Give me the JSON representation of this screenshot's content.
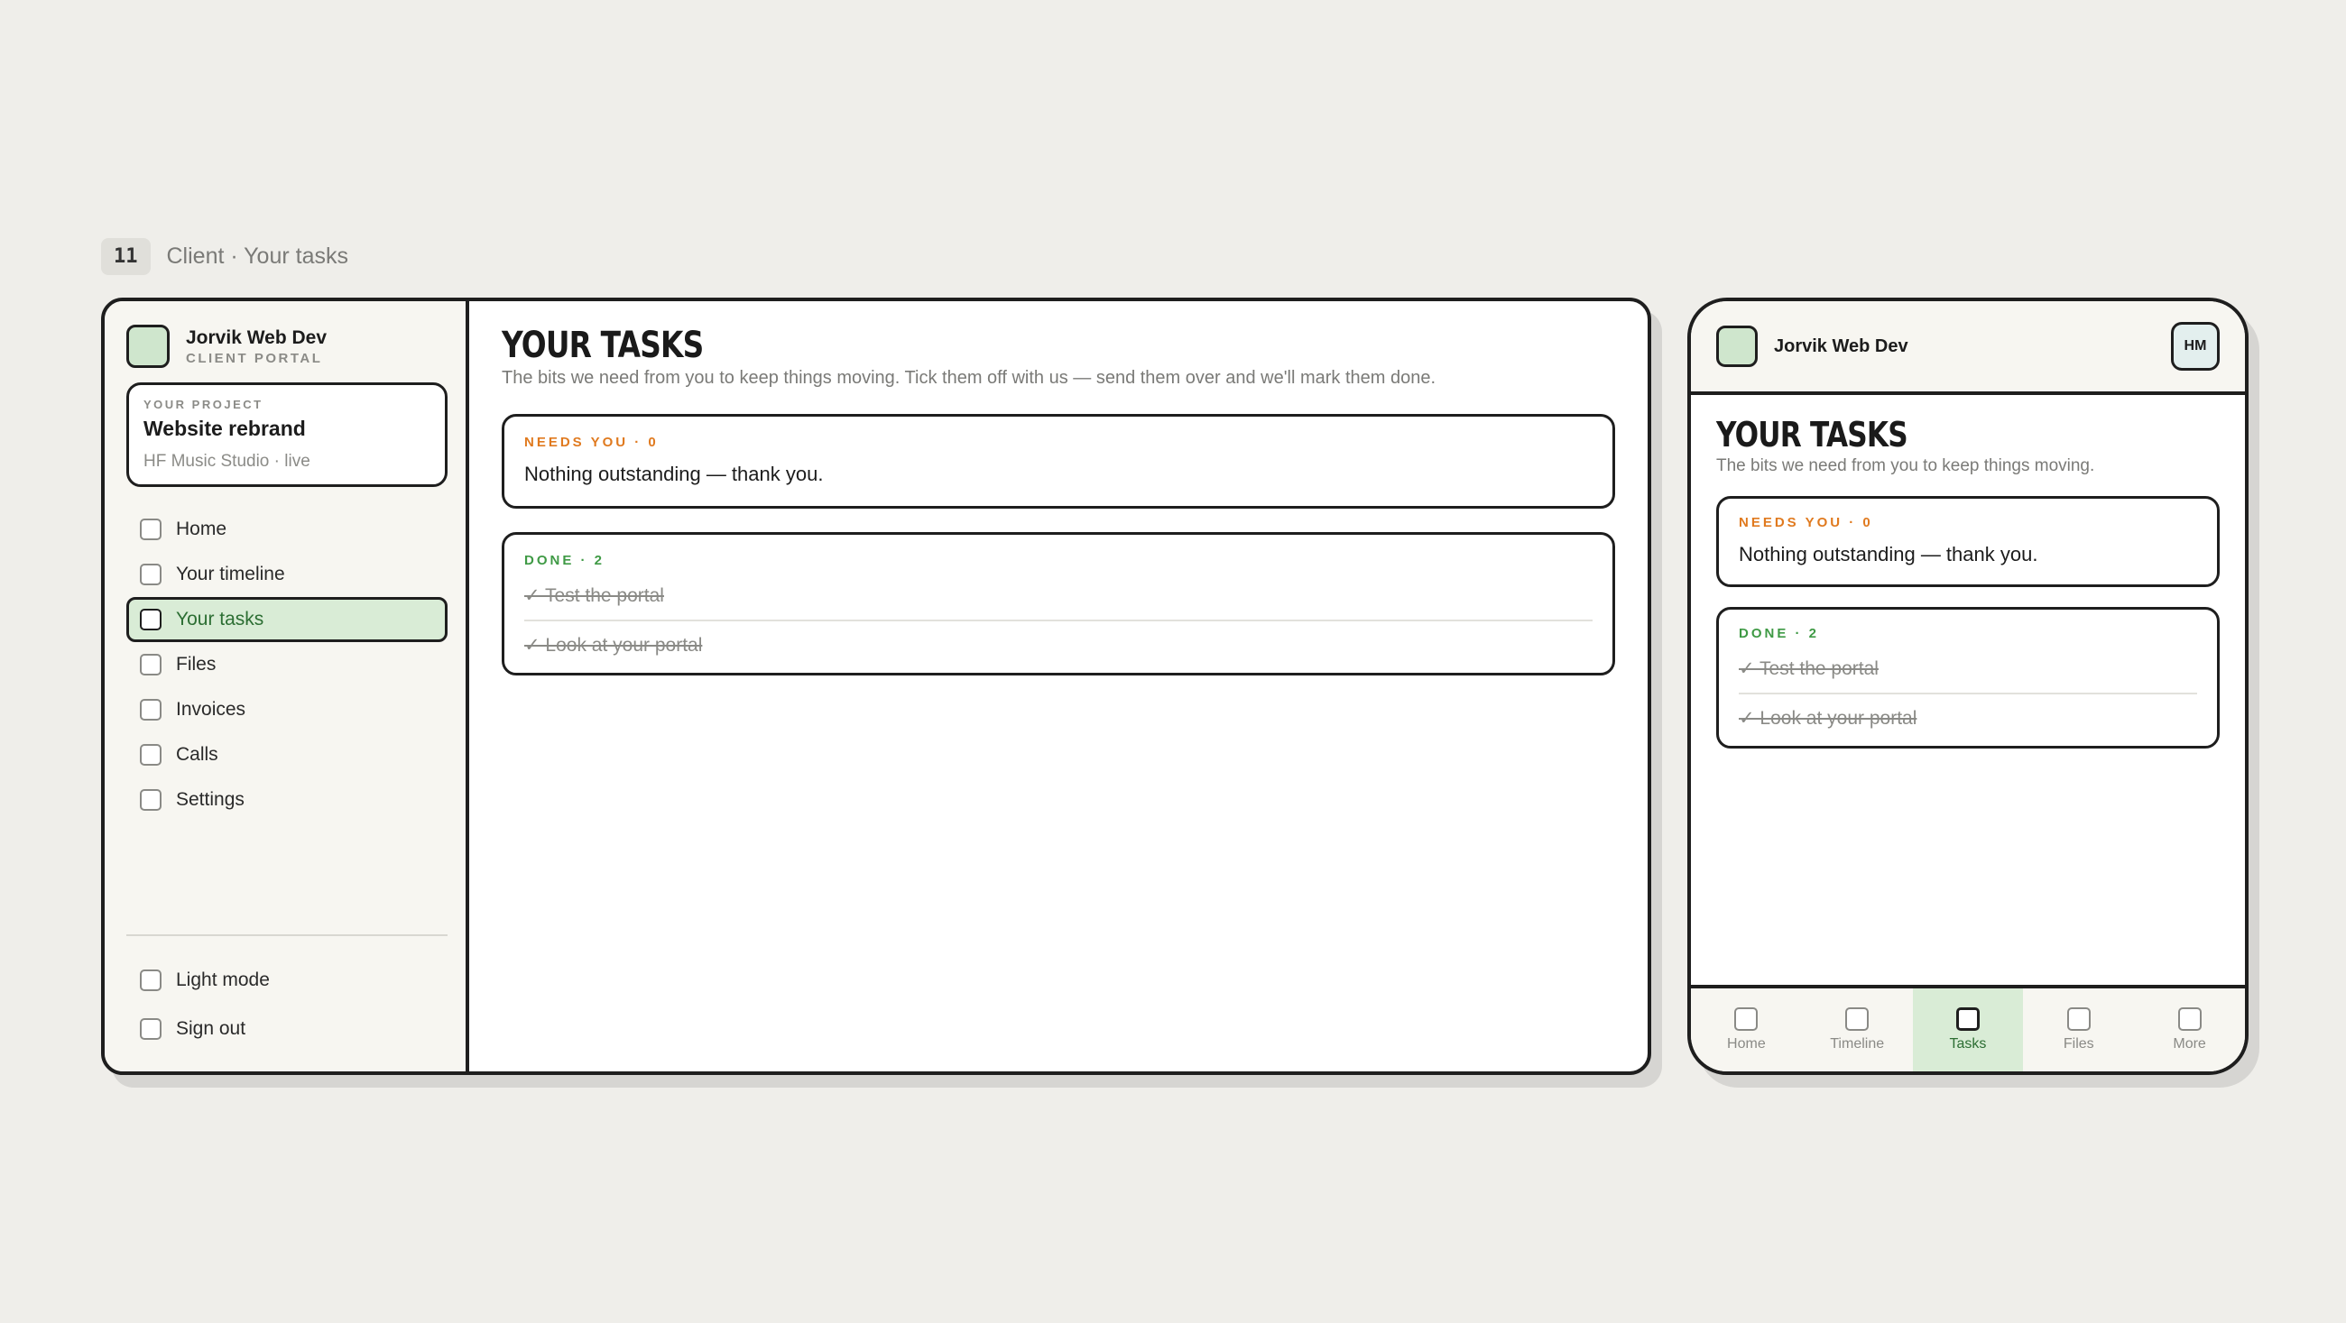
{
  "screen": {
    "number": "11",
    "title": "Client · Your tasks"
  },
  "brand": {
    "name": "Jorvik Web Dev",
    "subtitle": "CLIENT PORTAL"
  },
  "project": {
    "label": "YOUR PROJECT",
    "name": "Website rebrand",
    "meta": "HF Music Studio · live"
  },
  "nav": {
    "items": [
      {
        "label": "Home",
        "icon": "checkbox-icon"
      },
      {
        "label": "Your timeline",
        "icon": "checkbox-icon"
      },
      {
        "label": "Your tasks",
        "icon": "checkbox-icon",
        "active": true
      },
      {
        "label": "Files",
        "icon": "checkbox-icon"
      },
      {
        "label": "Invoices",
        "icon": "checkbox-icon"
      },
      {
        "label": "Calls",
        "icon": "checkbox-icon"
      },
      {
        "label": "Settings",
        "icon": "checkbox-icon"
      }
    ],
    "bottom": [
      {
        "label": "Light mode",
        "icon": "checkbox-icon"
      },
      {
        "label": "Sign out",
        "icon": "checkbox-icon"
      }
    ]
  },
  "page": {
    "title": "YOUR TASKS",
    "subtitle": "The bits we need from you to keep things moving. Tick them off with us — send them over and we'll mark them done.",
    "mobile_subtitle": "The bits we need from you to keep things moving."
  },
  "needs_you": {
    "heading": "NEEDS YOU · 0",
    "empty_text": "Nothing outstanding — thank you."
  },
  "done": {
    "heading": "DONE · 2",
    "items": [
      "✓ Test the portal",
      "✓ Look at your portal"
    ]
  },
  "mobile": {
    "avatar": "HM",
    "tabs": [
      {
        "label": "Home"
      },
      {
        "label": "Timeline"
      },
      {
        "label": "Tasks",
        "active": true
      },
      {
        "label": "Files"
      },
      {
        "label": "More"
      }
    ]
  },
  "colors": {
    "accent_green": "#3f9a45",
    "active_bg": "#d9ecd6",
    "needs_orange": "#e07a1f",
    "page_bg": "#efeeea"
  }
}
